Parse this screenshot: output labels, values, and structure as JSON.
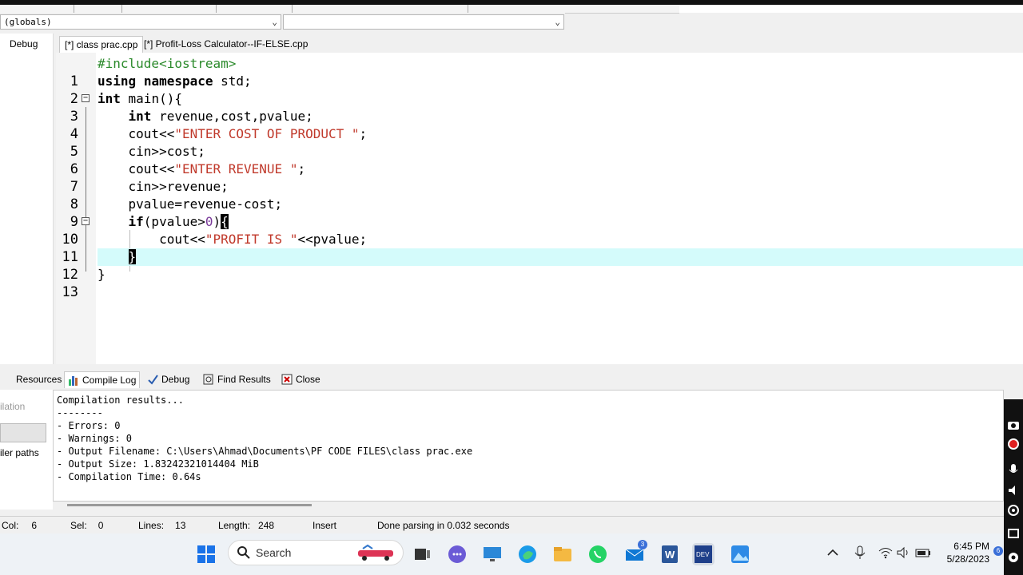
{
  "toolbar": {
    "globals_combo": "(globals)",
    "second_combo": ""
  },
  "left_panel": {
    "tab_label": "Debug"
  },
  "file_tabs": [
    {
      "label": "[*] class prac.cpp",
      "active": true
    },
    {
      "label": "[*] Profit-Loss Calculator--IF-ELSE.cpp",
      "active": false
    }
  ],
  "editor": {
    "line_numbers": [
      "1",
      "2",
      "3",
      "4",
      "5",
      "6",
      "7",
      "8",
      "9",
      "10",
      "11",
      "12",
      "13"
    ],
    "lines": [
      "#include<iostream>",
      "using namespace std;",
      "int main(){",
      "    int revenue,cost,pvalue;",
      "    cout<<\"ENTER COST OF PRODUCT \";",
      "    cin>>cost;",
      "    cout<<\"ENTER REVENUE \";",
      "    cin>>revenue;",
      "    pvalue=revenue-cost;",
      "    if(pvalue>0){",
      "        cout<<\"PROFIT IS \"<<pvalue;",
      "    }",
      "}"
    ],
    "highlighted_line": 12
  },
  "bottom_tabs": [
    {
      "label": "Resources",
      "icon": "resources-icon"
    },
    {
      "label": "Compile Log",
      "icon": "bar-chart-icon"
    },
    {
      "label": "Debug",
      "icon": "checkmark-icon"
    },
    {
      "label": "Find Results",
      "icon": "find-icon"
    },
    {
      "label": "Close",
      "icon": "close-icon"
    }
  ],
  "bottom_left": {
    "item1": "ilation",
    "item2": "iler paths"
  },
  "compile_log": [
    "Compilation results...",
    "--------",
    "- Errors: 0",
    "- Warnings: 0",
    "- Output Filename: C:\\Users\\Ahmad\\Documents\\PF CODE FILES\\class prac.exe",
    "- Output Size: 1.83242321014404 MiB",
    "- Compilation Time: 0.64s"
  ],
  "status_bar": {
    "col_label": "Col:",
    "col_value": "6",
    "sel_label": "Sel:",
    "sel_value": "0",
    "lines_label": "Lines:",
    "lines_value": "13",
    "length_label": "Length:",
    "length_value": "248",
    "mode": "Insert",
    "message": "Done parsing in 0.032 seconds"
  },
  "taskbar": {
    "search_placeholder": "Search",
    "time": "6:45 PM",
    "date": "5/28/2023",
    "mail_badge": "3",
    "notif_badge": "6"
  },
  "colors": {
    "highlight_line": "#d4fbfb",
    "string": "#c0392b",
    "preprocessor": "#2b8a2b",
    "number": "#7a3a9a"
  }
}
